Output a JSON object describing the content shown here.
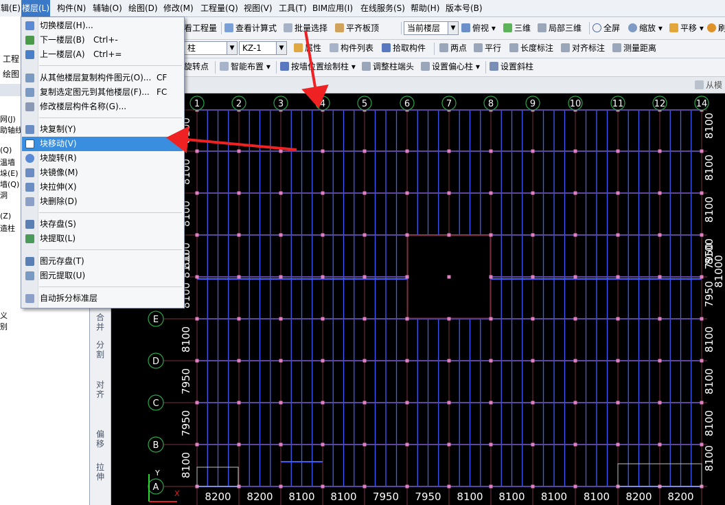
{
  "menubar": {
    "items": [
      "辑(E)",
      "楼层(L)",
      "构件(N)",
      "辅轴(O)",
      "绘图(D)",
      "修改(M)",
      "工程量(Q)",
      "视图(V)",
      "工具(T)",
      "BIM应用(I)",
      "在线服务(S)",
      "帮助(H)",
      "版本号(B)"
    ],
    "active_index": 1
  },
  "toolbar1": {
    "items": [
      "看工程量",
      "查看计算式",
      "批量选择",
      "平齐板顶"
    ],
    "floor_select": "当前楼层",
    "view_items": [
      "俯视",
      "三维",
      "局部三维",
      "全屏",
      "缩放",
      "平移",
      "刷"
    ]
  },
  "toolbar2": {
    "type_value": "柱",
    "component_value": "KZ-1",
    "items": [
      "属性",
      "构件列表",
      "拾取构件",
      "两点",
      "平行",
      "长度标注",
      "对齐标注",
      "测量距离"
    ]
  },
  "toolbar3": {
    "items": [
      "旋转点",
      "智能布置",
      "按墙位置绘制柱",
      "调整柱端头",
      "设置偏心柱",
      "设置斜柱"
    ],
    "right_text": "从模"
  },
  "left_panel": {
    "items": [
      "工程",
      "绘图",
      "网(J)",
      "助轴线",
      "(Q)",
      "温墙",
      "垛(E)",
      "墙(Q)",
      "洞",
      "(Z)",
      "造柱",
      "义",
      "别"
    ]
  },
  "edit_bar": {
    "items": [
      "合并",
      "分割",
      "对齐",
      "偏移",
      "拉伸"
    ]
  },
  "dropdown": {
    "items": [
      {
        "label": "切换楼层(H)...",
        "shortcut": ""
      },
      {
        "label": "下一楼层(B)",
        "shortcut": "Ctrl+-"
      },
      {
        "label": "上一楼层(A)",
        "shortcut": "Ctrl+="
      },
      {
        "label": "从其他楼层复制构件图元(O)...",
        "shortcut": "CF"
      },
      {
        "label": "复制选定图元到其他楼层(F)...",
        "shortcut": "FC"
      },
      {
        "label": "修改楼层构件名称(G)...",
        "shortcut": ""
      },
      {
        "label": "块复制(Y)",
        "shortcut": ""
      },
      {
        "label": "块移动(V)",
        "shortcut": ""
      },
      {
        "label": "块旋转(R)",
        "shortcut": ""
      },
      {
        "label": "块镜像(M)",
        "shortcut": ""
      },
      {
        "label": "块拉伸(X)",
        "shortcut": ""
      },
      {
        "label": "块删除(D)",
        "shortcut": ""
      },
      {
        "label": "块存盘(S)",
        "shortcut": ""
      },
      {
        "label": "块提取(L)",
        "shortcut": ""
      },
      {
        "label": "图元存盘(T)",
        "shortcut": ""
      },
      {
        "label": "图元提取(U)",
        "shortcut": ""
      },
      {
        "label": "自动拆分标准层",
        "shortcut": ""
      }
    ],
    "highlighted_index": 7
  },
  "canvas": {
    "grid_x_labels": [
      "1",
      "2",
      "3",
      "4",
      "5",
      "6",
      "7",
      "8",
      "9",
      "10",
      "11",
      "12",
      "13",
      "14"
    ],
    "grid_y_labels": [
      "A",
      "B",
      "C",
      "D",
      "E"
    ],
    "bottom_dims": [
      "8200",
      "8200",
      "8100",
      "8100",
      "7950",
      "7950",
      "8100",
      "8100",
      "8100",
      "8100",
      "8200",
      "8200"
    ],
    "left_dims": [
      "8100",
      "8100",
      "8100",
      "8100",
      "8100",
      "8100",
      "8100",
      "7950",
      "7950",
      "8100",
      "8100"
    ],
    "right_dims": [
      "8100",
      "8100",
      "8100",
      "8100",
      "7950",
      "7950",
      "8100",
      "8100",
      "8100",
      "8100",
      "8100"
    ],
    "right_total": "81000",
    "axis_y_label": "Y",
    "axis_x_label": "X",
    "colors": {
      "background": "#000000",
      "grid": "#7a3040",
      "beam": "#3f5cff",
      "bubble": "#2aa64a",
      "dim_text": "#ffffff",
      "arrow": "#ee2222"
    }
  },
  "colors": {
    "menu_active": "#3a78c8",
    "highlight": "#3a8ee0"
  }
}
